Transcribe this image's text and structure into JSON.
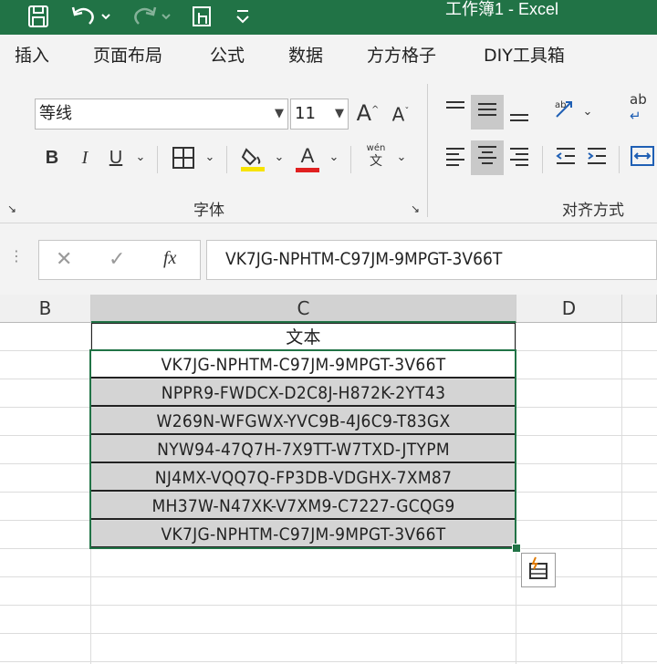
{
  "titlebar": {
    "title": "工作簿1  -  Excel",
    "save_icon": "save-icon",
    "undo_icon": "undo-icon",
    "redo_icon": "redo-icon",
    "touch_icon": "touch-mode-icon",
    "customize_icon": "customize-toolbar-icon"
  },
  "menu": {
    "tabs": [
      "插入",
      "页面布局",
      "公式",
      "数据",
      "方方格子",
      "DIY工具箱"
    ]
  },
  "ribbon": {
    "font_name": "等线",
    "font_size": "11",
    "grow_font": "A",
    "shrink_font": "A",
    "bold": "B",
    "italic": "I",
    "underline": "U",
    "font_color_letter": "A",
    "phonetic_top": "wén",
    "phonetic_bottom": "文",
    "font_group_label": "字体",
    "align_group_label": "对齐方式",
    "wrap_label": "ab",
    "highlight_color": "#f7e300",
    "font_color": "#e02020"
  },
  "formula_bar": {
    "cancel": "✕",
    "enter": "✓",
    "fx": "fx",
    "value": "VK7JG-NPHTM-C97JM-9MPGT-3V66T"
  },
  "sheet": {
    "columns": [
      "B",
      "C",
      "D"
    ],
    "header_cell": "文本",
    "rows": [
      "VK7JG-NPHTM-C97JM-9MPGT-3V66T",
      "NPPR9-FWDCX-D2C8J-H872K-2YT43",
      "W269N-WFGWX-YVC9B-4J6C9-T83GX",
      "NYW94-47Q7H-7X9TT-W7TXD-JTYPM",
      "NJ4MX-VQQ7Q-FP3DB-VDGHX-7XM87",
      "MH37W-N47XK-V7XM9-C7227-GCQG9",
      "VK7JG-NPHTM-C97JM-9MPGT-3V66T"
    ],
    "accent": "#217346"
  }
}
